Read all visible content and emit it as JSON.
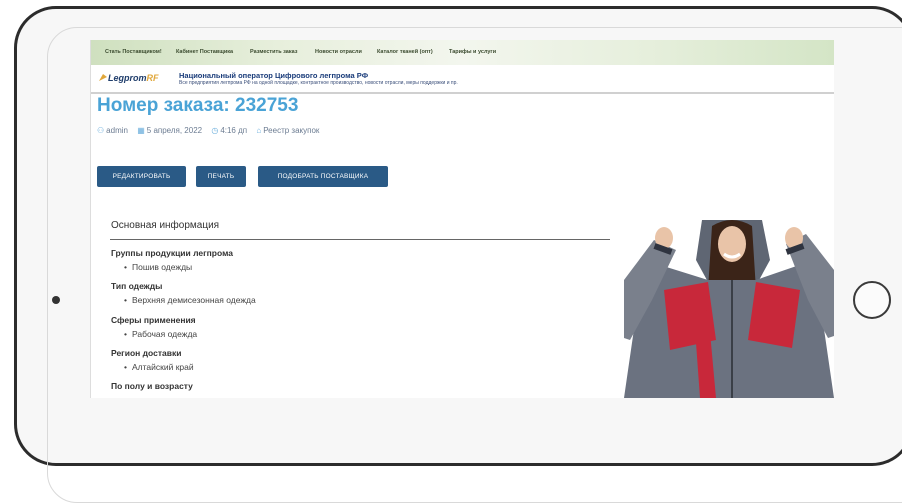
{
  "device": {
    "type": "tablet"
  },
  "nav": {
    "items": [
      "Стать Поставщиком!",
      "Кабинет Поставщика",
      "Разместить заказ",
      "Новости отрасли",
      "Каталог тканей (опт)",
      "Тарифы и услуги"
    ]
  },
  "brand": {
    "logo_main": "Legprom",
    "logo_rf": "RF",
    "title": "Национальный оператор Цифрового легпрома РФ",
    "subtitle": "Все предприятия легпрома РФ на одной площадке, контрактное производство, новости отрасли, меры поддержки и пр."
  },
  "order": {
    "title": "Номер заказа: 232753",
    "author": "admin",
    "date": "5 апреля, 2022",
    "time": "4:16 дп",
    "category": "Реестр закупок"
  },
  "buttons": {
    "edit": "РЕДАКТИРОВАТЬ",
    "print": "ПЕЧАТЬ",
    "pick_supplier": "ПОДОБРАТЬ ПОСТАВЩИКА"
  },
  "info": {
    "section_title": "Основная информация",
    "fields": [
      {
        "label": "Группы продукции легпрома",
        "value": "Пошив одежды"
      },
      {
        "label": "Тип одежды",
        "value": "Верхняя демисезонная одежда"
      },
      {
        "label": "Сферы применения",
        "value": "Рабочая одежда"
      },
      {
        "label": "Регион доставки",
        "value": "Алтайский край"
      },
      {
        "label": "По полу и возрасту",
        "value": ""
      }
    ]
  },
  "colors": {
    "accent_title": "#4aa3d6",
    "button_bg": "#2a5a86",
    "nav_bg": "#dfe9d2",
    "jacket_gray": "#6b7280",
    "jacket_red": "#c8283a"
  }
}
